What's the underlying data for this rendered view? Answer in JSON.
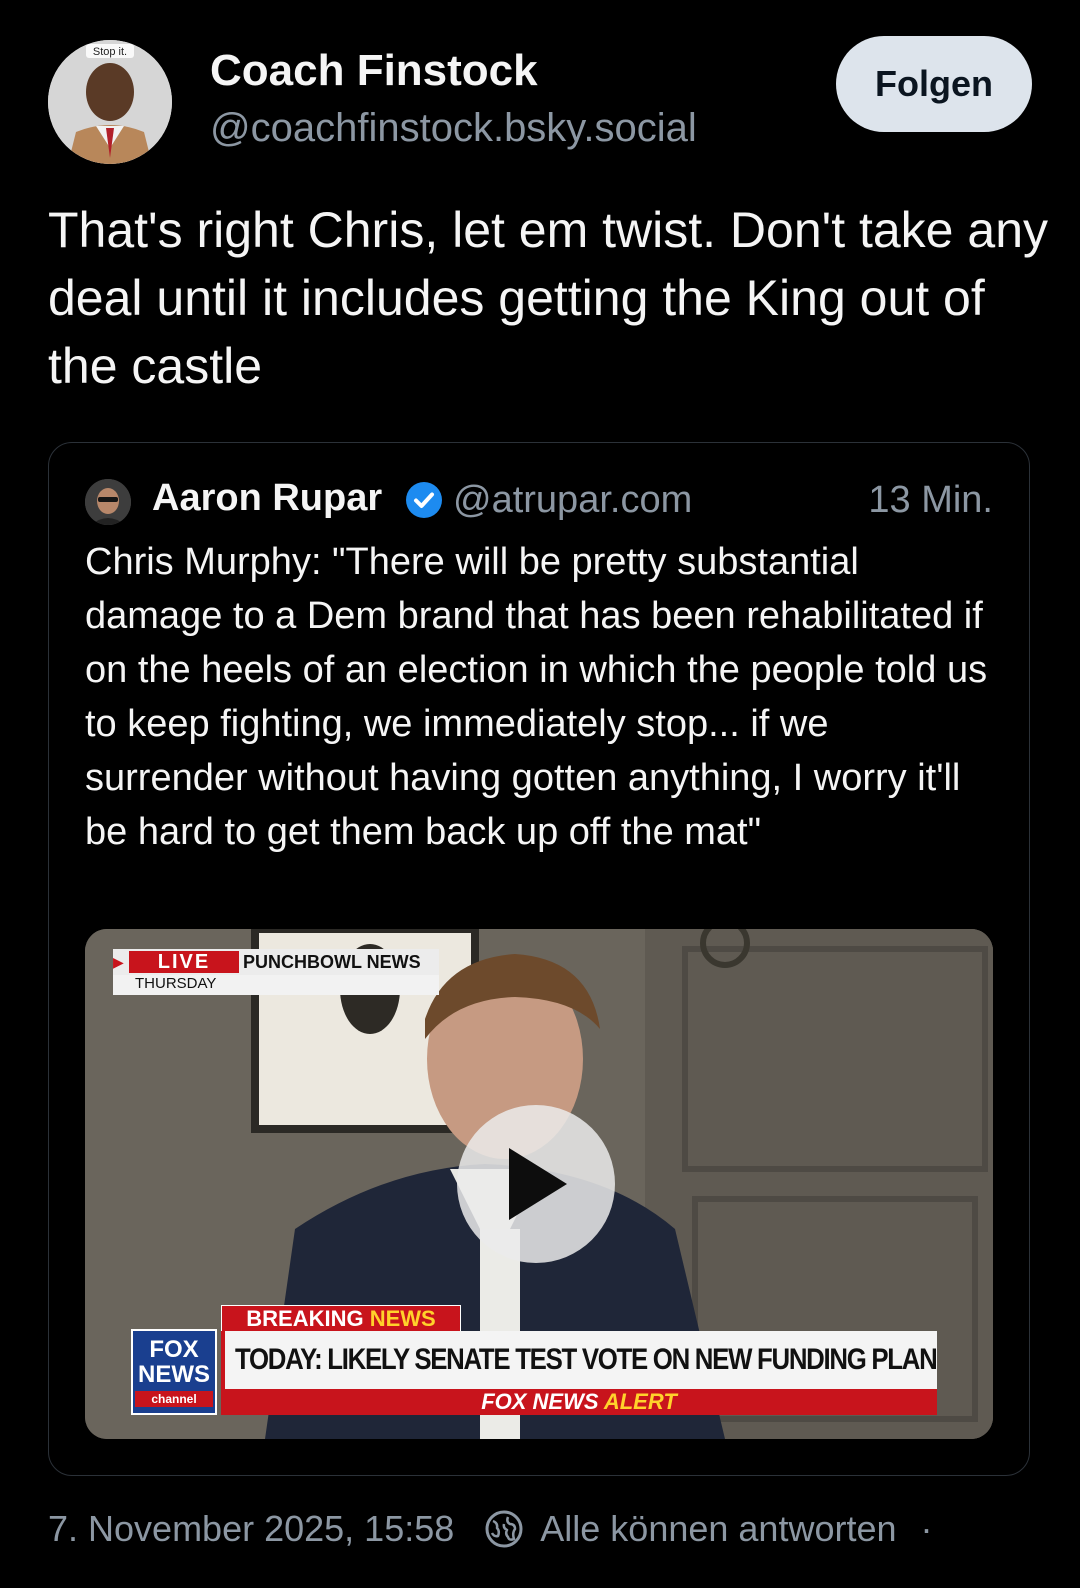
{
  "post": {
    "author_name": "Coach Finstock",
    "author_handle": "@coachfinstock.bsky.social",
    "avatar_caption": "Stop it.",
    "follow_label": "Folgen",
    "text": "That's right Chris, let em twist. Don't take any deal until it includes getting the King out of the castle"
  },
  "quote": {
    "author_name": "Aaron Rupar",
    "author_handle": "@atrupar.com",
    "time": "13 Min.",
    "text": "Chris Murphy: \"There will be pretty substantial damage to a Dem brand that has been rehabilitated if on the heels of an election in which the people told us to keep fighting, we immediately stop... if we surrender without having gotten anything, I worry it'll be hard to get them back up off the mat\"",
    "video": {
      "live_label": "LIVE",
      "source_label": "PUNCHBOWL NEWS",
      "day_label": "THURSDAY",
      "breaking_label_1": "BREAKING",
      "breaking_label_2": "NEWS",
      "headline": "TODAY: LIKELY SENATE TEST VOTE ON NEW FUNDING PLAN",
      "network_line1": "FOX",
      "network_line2": "NEWS",
      "network_line3": "channel",
      "alert_1": "FOX NEWS",
      "alert_2": "ALERT"
    }
  },
  "footer": {
    "date": "7. November 2025, 15:58",
    "reply_setting": "Alle können antworten",
    "separator": "·"
  },
  "colors": {
    "background": "#000000",
    "muted_text": "#8c97a3",
    "follow_button": "#dde4ec",
    "verified_blue": "#1d8bf0",
    "fox_red": "#c8141c",
    "fox_blue": "#1a3f8f"
  }
}
